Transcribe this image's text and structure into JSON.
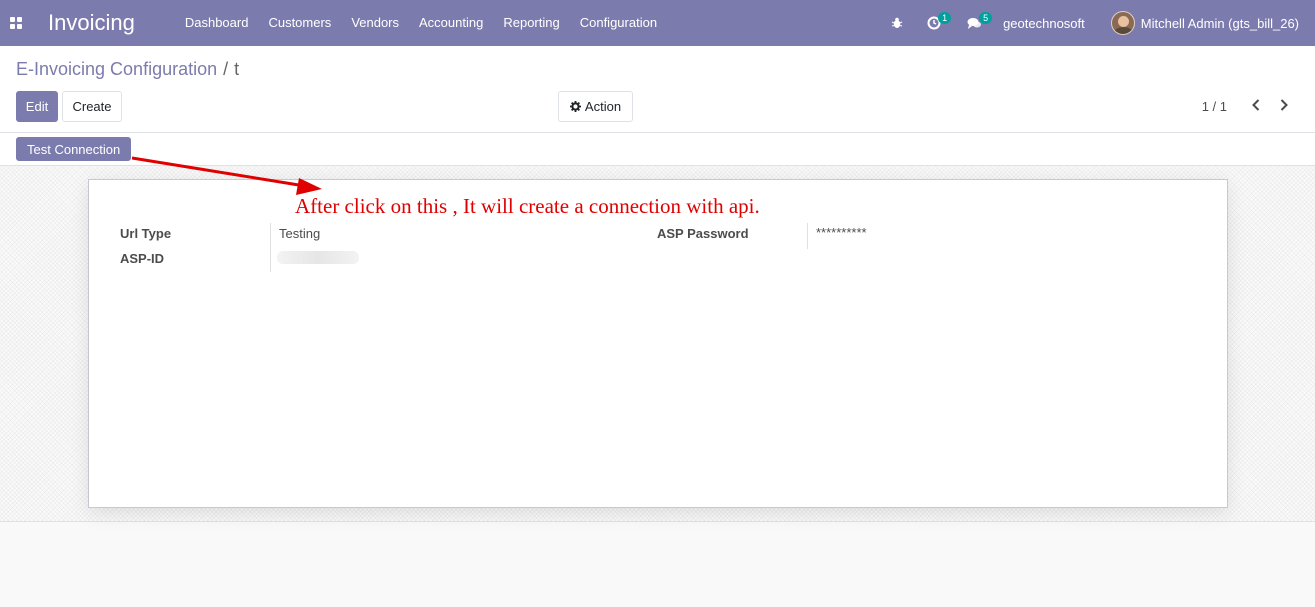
{
  "navbar": {
    "app_name": "Invoicing",
    "menu": [
      "Dashboard",
      "Customers",
      "Vendors",
      "Accounting",
      "Reporting",
      "Configuration"
    ],
    "activity_count": "1",
    "messages_count": "5",
    "company": "geotechnosoft",
    "user": "Mitchell Admin (gts_bill_26)",
    "icons": [
      "apps-grid-icon",
      "bug-icon",
      "clock-icon",
      "chat-icon"
    ]
  },
  "breadcrumb": {
    "parent": "E-Invoicing Configuration",
    "separator": "/",
    "current": "t"
  },
  "toolbar": {
    "edit_label": "Edit",
    "create_label": "Create",
    "action_label": "Action",
    "pager": "1 / 1"
  },
  "statusbar": {
    "test_connection_label": "Test Connection"
  },
  "annotation": {
    "text": "After click on this , It will create a connection with api."
  },
  "form": {
    "url_type_label": "Url Type",
    "url_type_value": "Testing",
    "asp_id_label": "ASP-ID",
    "asp_password_label": "ASP Password",
    "asp_password_value": "**********"
  },
  "colors": {
    "brand": "#7c7bad",
    "badge": "#00a09d",
    "annotation": "#e00000"
  }
}
